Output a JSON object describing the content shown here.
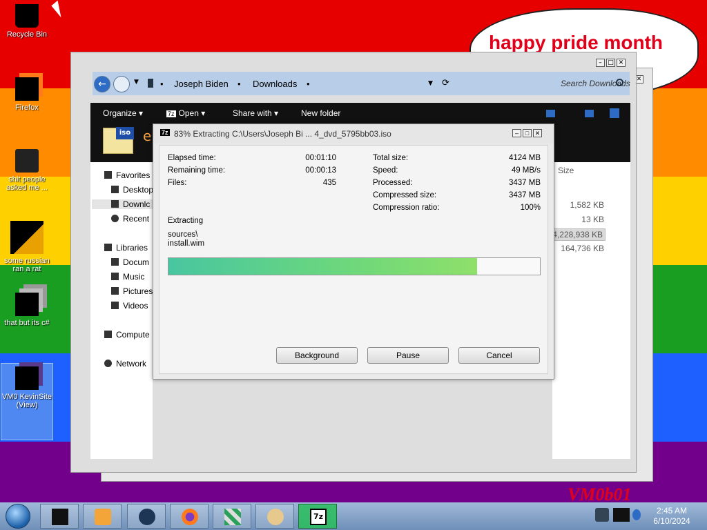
{
  "wallpaper": {
    "bands": [
      "#e60000",
      "#ff8c00",
      "#ffd000",
      "#1a9e22",
      "#1e60ff",
      "#73008a"
    ]
  },
  "desktop": {
    "icons": [
      {
        "label": "Recycle Bin",
        "icon": "recycle-bin-icon"
      },
      {
        "label": "Firefox",
        "icon": "firefox-icon"
      },
      {
        "label": "shit people asked me ...",
        "icon": "file-icon"
      },
      {
        "label": "some russian ran a rat",
        "icon": "ie-icon"
      },
      {
        "label": "that but its c#",
        "icon": "copy-icon"
      },
      {
        "label": "VM0 KevinSite (View)",
        "icon": "app-icon"
      }
    ],
    "bubble_text": "happy pride month",
    "signature": "VM0b01"
  },
  "explorer": {
    "breadcrumb": [
      "Joseph Biden",
      "Downloads"
    ],
    "search_placeholder": "Search Downloads",
    "toolbar": {
      "organize": "Organize",
      "open": "Open",
      "share_with": "Share with",
      "new_folder": "New folder"
    },
    "folder_header_fragment": "e",
    "nav": {
      "favorites": "Favorites",
      "desktop": "Desktop",
      "downloads": "Downlc",
      "recent": "Recent",
      "libraries": "Libraries",
      "documents": "Docum",
      "music": "Music",
      "pictures": "Pictures",
      "videos": "Videos",
      "computer": "Compute",
      "network": "Network"
    },
    "size_header": "Size",
    "sizes": [
      "1,582 KB",
      "13 KB",
      "4,228,938 KB",
      "164,736 KB"
    ]
  },
  "dialog": {
    "title": "83% Extracting C:\\Users\\Joseph Bi ... 4_dvd_5795bb03.iso",
    "app_badge": "7z",
    "stats_left": [
      {
        "label": "Elapsed time:",
        "value": "00:01:10"
      },
      {
        "label": "Remaining time:",
        "value": "00:00:13"
      },
      {
        "label": "Files:",
        "value": "435"
      }
    ],
    "stats_right": [
      {
        "label": "Total size:",
        "value": "4124 MB"
      },
      {
        "label": "Speed:",
        "value": "49 MB/s"
      },
      {
        "label": "Processed:",
        "value": "3437 MB"
      },
      {
        "label": "Compressed size:",
        "value": "3437 MB"
      },
      {
        "label": "Compression ratio:",
        "value": "100%"
      }
    ],
    "status": "Extracting",
    "path_line1": "sources\\",
    "path_line2": "install.wim",
    "progress": 0.83,
    "buttons": {
      "background": "Background",
      "pause": "Pause",
      "cancel": "Cancel"
    }
  },
  "taskbar": {
    "apps": [
      "start-orb-icon",
      "window-icon",
      "media-player-icon",
      "globe-icon",
      "firefox-icon",
      "blocks-icon",
      "paint-icon",
      "7zip-icon"
    ],
    "time": "2:45 AM",
    "date": "6/10/2024"
  }
}
